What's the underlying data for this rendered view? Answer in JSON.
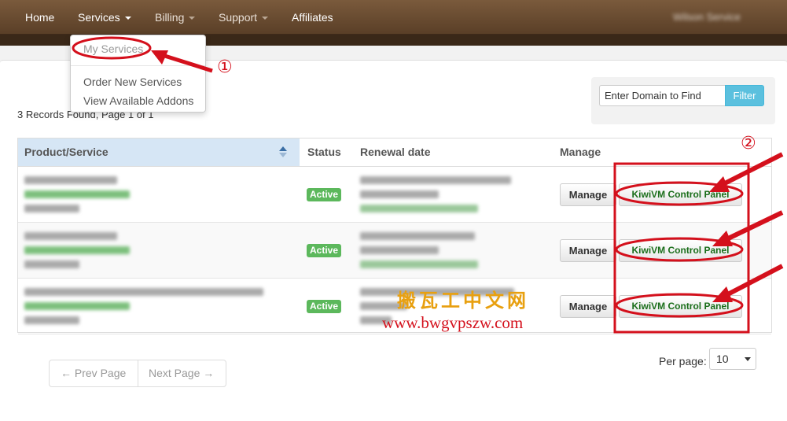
{
  "nav": {
    "items": [
      {
        "label": "Home"
      },
      {
        "label": "Services"
      },
      {
        "label": "Billing"
      },
      {
        "label": "Support"
      },
      {
        "label": "Affiliates"
      }
    ],
    "user": "Wilson Service"
  },
  "dropdown": {
    "items": [
      {
        "label": "My Services"
      },
      {
        "label": "Order New Services"
      },
      {
        "label": "View Available Addons"
      }
    ]
  },
  "records_text": "3 Records Found, Page 1 of 1",
  "filter": {
    "placeholder": "Enter Domain to Find",
    "button": "Filter"
  },
  "table": {
    "headers": {
      "product": "Product/Service",
      "status": "Status",
      "renewal": "Renewal date",
      "manage": "Manage"
    },
    "rows": [
      {
        "status": "Active",
        "manage": "Manage",
        "panel": "KiwiVM Control Panel"
      },
      {
        "status": "Active",
        "manage": "Manage",
        "panel": "KiwiVM Control Panel"
      },
      {
        "status": "Active",
        "manage": "Manage",
        "panel": "KiwiVM Control Panel"
      }
    ]
  },
  "pager": {
    "prev": "← Prev Page",
    "next": "Next Page →"
  },
  "per_page": {
    "label": "Per page:",
    "value": "10"
  },
  "annotations": {
    "marker_1": "①",
    "marker_2": "②",
    "watermark_cn": "搬瓦工中文网",
    "watermark_url": "www.bwgvpszw.com",
    "color": "#d4101c"
  },
  "colors": {
    "nav": "#6b4b30",
    "active": "#5cb85c",
    "filter": "#5bc0de",
    "panel_text": "#1a6e1a"
  }
}
